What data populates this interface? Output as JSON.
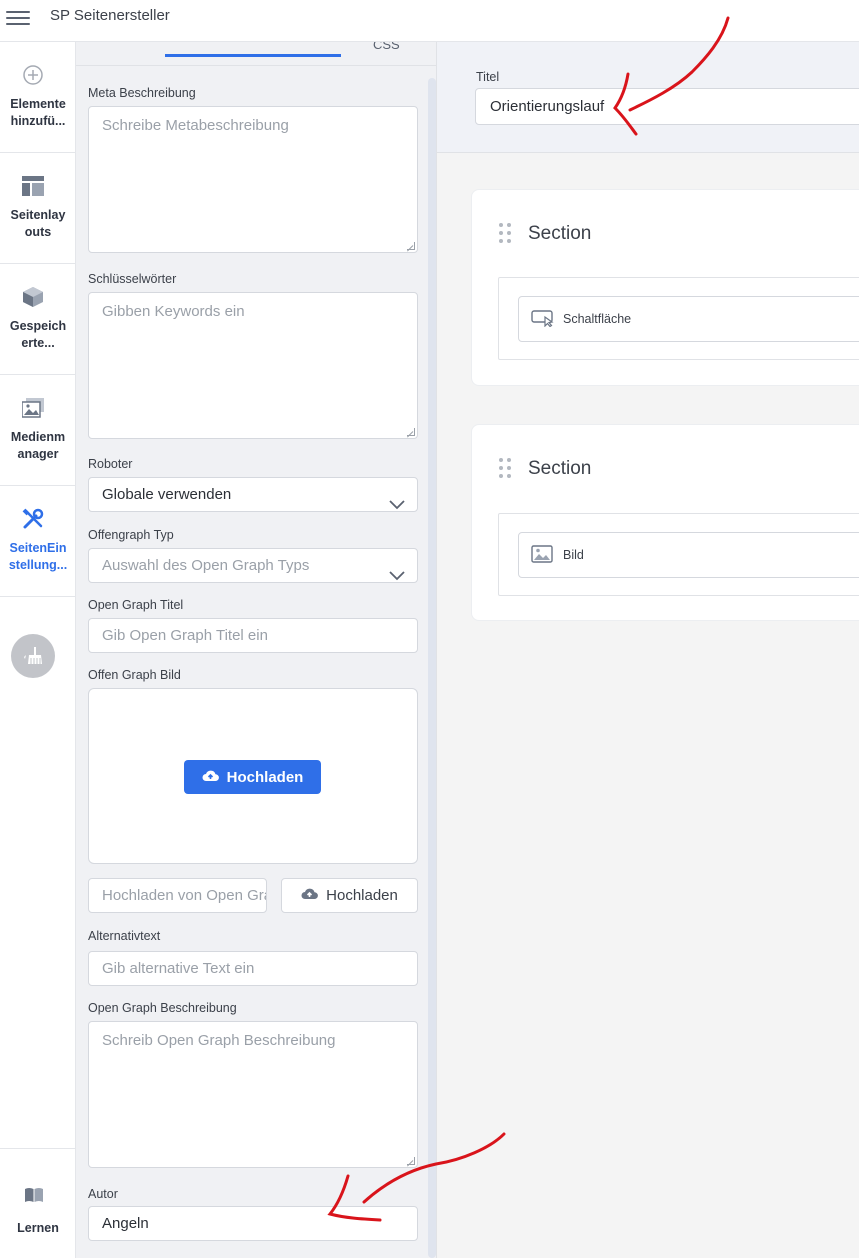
{
  "app": {
    "title": "SP Seitenersteller"
  },
  "rail": {
    "items": [
      {
        "label": "Elemente hinzufü...",
        "icon": "plus-circle-icon"
      },
      {
        "label": "Seitenlay outs",
        "icon": "layout-icon"
      },
      {
        "label": "Gespeich erte...",
        "icon": "cube-icon"
      },
      {
        "label": "Medienm anager",
        "icon": "media-icon"
      },
      {
        "label": "SeitenEin stellung...",
        "icon": "tools-icon",
        "active": true
      }
    ],
    "clean_icon": "broom-icon",
    "learn": {
      "label": "Lernen",
      "icon": "book-icon"
    }
  },
  "panel": {
    "tabs": {
      "css": "CSS"
    },
    "meta_description": {
      "label": "Meta Beschreibung",
      "placeholder": "Schreibe Metabeschreibung"
    },
    "keywords": {
      "label": "Schlüsselwörter",
      "placeholder": "Gibben Keywords ein"
    },
    "robots": {
      "label": "Roboter",
      "value": "Globale verwenden"
    },
    "og_type": {
      "label": "Offengraph Typ",
      "placeholder": "Auswahl des Open Graph Typs"
    },
    "og_title": {
      "label": "Open Graph Titel",
      "placeholder": "Gib Open Graph Titel ein"
    },
    "og_image": {
      "label": "Offen Graph Bild",
      "upload_button": "Hochladen"
    },
    "og_image_url": {
      "placeholder": "Hochladen von Open Graph Bild",
      "button": "Hochladen"
    },
    "alt_text": {
      "label": "Alternativtext",
      "placeholder": "Gib alternative Text ein"
    },
    "og_description": {
      "label": "Open Graph Beschreibung",
      "placeholder": "Schreib Open Graph Beschreibung"
    },
    "author": {
      "label": "Autor",
      "value": "Angeln"
    }
  },
  "main": {
    "title": {
      "label": "Titel",
      "value": "Orientierungslauf"
    },
    "sections": [
      {
        "title": "Section",
        "element": {
          "label": "Schaltfläche",
          "icon": "button-cursor-icon"
        }
      },
      {
        "title": "Section",
        "element": {
          "label": "Bild",
          "icon": "image-icon"
        }
      }
    ]
  },
  "annotations": {
    "color": "#d9141b"
  }
}
